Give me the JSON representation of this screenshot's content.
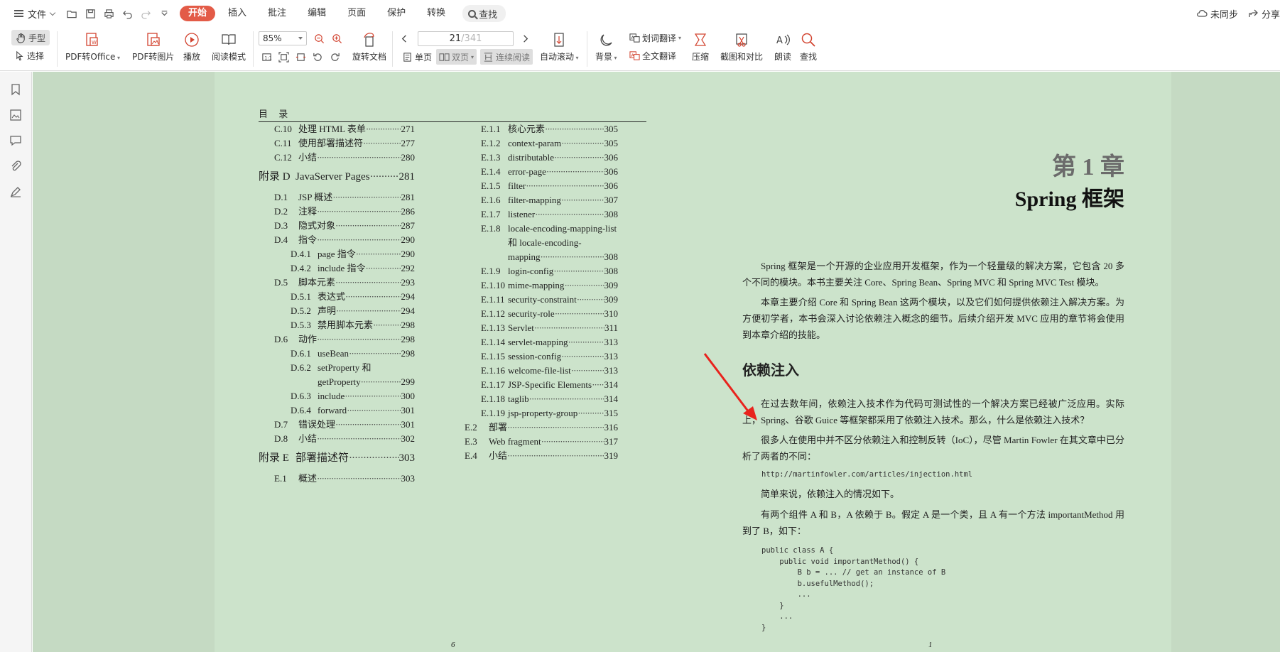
{
  "menubar": {
    "file_label": "文件",
    "tabs": [
      "开始",
      "插入",
      "批注",
      "编辑",
      "页面",
      "保护",
      "转换"
    ],
    "active_tab": "开始",
    "search_label": "查找",
    "sync_label": "未同步",
    "share_label": "分享"
  },
  "ribbon": {
    "hand_label": "手型",
    "select_label": "选择",
    "pdf_to_office": "PDF转Office",
    "pdf_to_image": "PDF转图片",
    "play": "播放",
    "read_mode": "阅读模式",
    "zoom_value": "85%",
    "rotate_doc": "旋转文档",
    "page_current": "21",
    "page_total": "/341",
    "single_page": "单页",
    "double_page": "双页",
    "continuous": "连续阅读",
    "auto_scroll": "自动滚动",
    "background": "背景",
    "word_translate": "划词翻译",
    "full_translate": "全文翻译",
    "compress": "压缩",
    "crop_compare": "截图和对比",
    "read_aloud": "朗读",
    "find": "查找"
  },
  "left_page": {
    "header": "目 录",
    "page_number": "6",
    "col1": [
      {
        "num": "C.10",
        "title": "处理 HTML 表单",
        "page": "271",
        "level": 1
      },
      {
        "num": "C.11",
        "title": "使用部署描述符",
        "page": "277",
        "level": 1
      },
      {
        "num": "C.12",
        "title": "小结",
        "page": "280",
        "level": 1
      },
      {
        "num": "附录 D",
        "title": "JavaServer Pages",
        "page": "281",
        "level": 0
      },
      {
        "num": "D.1",
        "title": "JSP 概述",
        "page": "281",
        "level": 1
      },
      {
        "num": "D.2",
        "title": "注释",
        "page": "286",
        "level": 1
      },
      {
        "num": "D.3",
        "title": "隐式对象",
        "page": "287",
        "level": 1
      },
      {
        "num": "D.4",
        "title": "指令",
        "page": "290",
        "level": 1
      },
      {
        "num": "D.4.1",
        "title": "page 指令",
        "page": "290",
        "level": 2
      },
      {
        "num": "D.4.2",
        "title": "include 指令",
        "page": "292",
        "level": 2
      },
      {
        "num": "D.5",
        "title": "脚本元素",
        "page": "293",
        "level": 1
      },
      {
        "num": "D.5.1",
        "title": "表达式",
        "page": "294",
        "level": 2
      },
      {
        "num": "D.5.2",
        "title": "声明",
        "page": "294",
        "level": 2
      },
      {
        "num": "D.5.3",
        "title": "禁用脚本元素",
        "page": "298",
        "level": 2
      },
      {
        "num": "D.6",
        "title": "动作",
        "page": "298",
        "level": 1
      },
      {
        "num": "D.6.1",
        "title": "useBean",
        "page": "298",
        "level": 2
      },
      {
        "num": "D.6.2",
        "title": "setProperty 和",
        "page": "",
        "level": 2
      },
      {
        "num": "",
        "title": "getProperty",
        "page": "299",
        "level": 2
      },
      {
        "num": "D.6.3",
        "title": "include",
        "page": "300",
        "level": 2
      },
      {
        "num": "D.6.4",
        "title": "forward",
        "page": "301",
        "level": 2
      },
      {
        "num": "D.7",
        "title": "错误处理",
        "page": "301",
        "level": 1
      },
      {
        "num": "D.8",
        "title": "小结",
        "page": "302",
        "level": 1
      },
      {
        "num": "附录 E",
        "title": "部署描述符",
        "page": "303",
        "level": 0
      },
      {
        "num": "E.1",
        "title": "概述",
        "page": "303",
        "level": 1
      }
    ],
    "col2": [
      {
        "num": "E.1.1",
        "title": "核心元素",
        "page": "305",
        "level": 2
      },
      {
        "num": "E.1.2",
        "title": "context-param",
        "page": "305",
        "level": 2
      },
      {
        "num": "E.1.3",
        "title": "distributable",
        "page": "306",
        "level": 2
      },
      {
        "num": "E.1.4",
        "title": "error-page",
        "page": "306",
        "level": 2
      },
      {
        "num": "E.1.5",
        "title": "filter",
        "page": "306",
        "level": 2
      },
      {
        "num": "E.1.6",
        "title": "filter-mapping",
        "page": "307",
        "level": 2
      },
      {
        "num": "E.1.7",
        "title": "listener",
        "page": "308",
        "level": 2
      },
      {
        "num": "E.1.8",
        "title": "locale-encoding-mapping-list",
        "page": "",
        "level": 2
      },
      {
        "num": "",
        "title": "和 locale-encoding-",
        "page": "",
        "level": 2
      },
      {
        "num": "",
        "title": "mapping",
        "page": "308",
        "level": 2
      },
      {
        "num": "E.1.9",
        "title": "login-config",
        "page": "308",
        "level": 2
      },
      {
        "num": "E.1.10",
        "title": "mime-mapping",
        "page": "309",
        "level": 2
      },
      {
        "num": "E.1.11",
        "title": "security-constraint",
        "page": "309",
        "level": 2
      },
      {
        "num": "E.1.12",
        "title": "security-role",
        "page": "310",
        "level": 2
      },
      {
        "num": "E.1.13",
        "title": "Servlet",
        "page": "311",
        "level": 2
      },
      {
        "num": "E.1.14",
        "title": "servlet-mapping",
        "page": "313",
        "level": 2
      },
      {
        "num": "E.1.15",
        "title": "session-config",
        "page": "313",
        "level": 2
      },
      {
        "num": "E.1.16",
        "title": "welcome-file-list",
        "page": "313",
        "level": 2
      },
      {
        "num": "E.1.17",
        "title": "JSP-Specific Elements",
        "page": "314",
        "level": 2
      },
      {
        "num": "E.1.18",
        "title": "taglib",
        "page": "314",
        "level": 2
      },
      {
        "num": "E.1.19",
        "title": "jsp-property-group",
        "page": "315",
        "level": 2
      },
      {
        "num": "E.2",
        "title": "部署",
        "page": "316",
        "level": 1
      },
      {
        "num": "E.3",
        "title": "Web fragment",
        "page": "317",
        "level": 1
      },
      {
        "num": "E.4",
        "title": "小结",
        "page": "319",
        "level": 1
      }
    ]
  },
  "right_page": {
    "chapter_number": "第 1 章",
    "chapter_title": "Spring 框架",
    "para1": "Spring 框架是一个开源的企业应用开发框架，作为一个轻量级的解决方案，它包含 20 多个不同的模块。本书主要关注 Core、Spring Bean、Spring MVC 和 Spring MVC Test 模块。",
    "para2": "本章主要介绍 Core 和 Spring Bean 这两个模块，以及它们如何提供依赖注入解决方案。为方便初学者，本书会深入讨论依赖注入概念的细节。后续介绍开发 MVC 应用的章节将会使用到本章介绍的技能。",
    "section_title": "依赖注入",
    "para3": "在过去数年间，依赖注入技术作为代码可测试性的一个解决方案已经被广泛应用。实际上，Spring、谷歌 Guice 等框架都采用了依赖注入技术。那么，什么是依赖注入技术？",
    "para4": "很多人在使用中并不区分依赖注入和控制反转（IoC），尽管 Martin Fowler 在其文章中已分析了两者的不同：",
    "url": "http://martinfowler.com/articles/injection.html",
    "para5": "简单来说，依赖注入的情况如下。",
    "para6": "有两个组件 A 和 B，A 依赖于 B。假定 A 是一个类，且 A 有一个方法 importantMethod 用到了 B，如下：",
    "code": "public class A {\n    public void importantMethod() {\n        B b = ... // get an instance of B\n        b.usefulMethod();\n        ...\n    }\n    ...\n}",
    "page_number": "1"
  },
  "colors": {
    "page_bg": "#cce3cb",
    "workspace_bg": "#c5dac3",
    "accent": "#e35b47",
    "annotation_arrow": "#e8231d"
  }
}
